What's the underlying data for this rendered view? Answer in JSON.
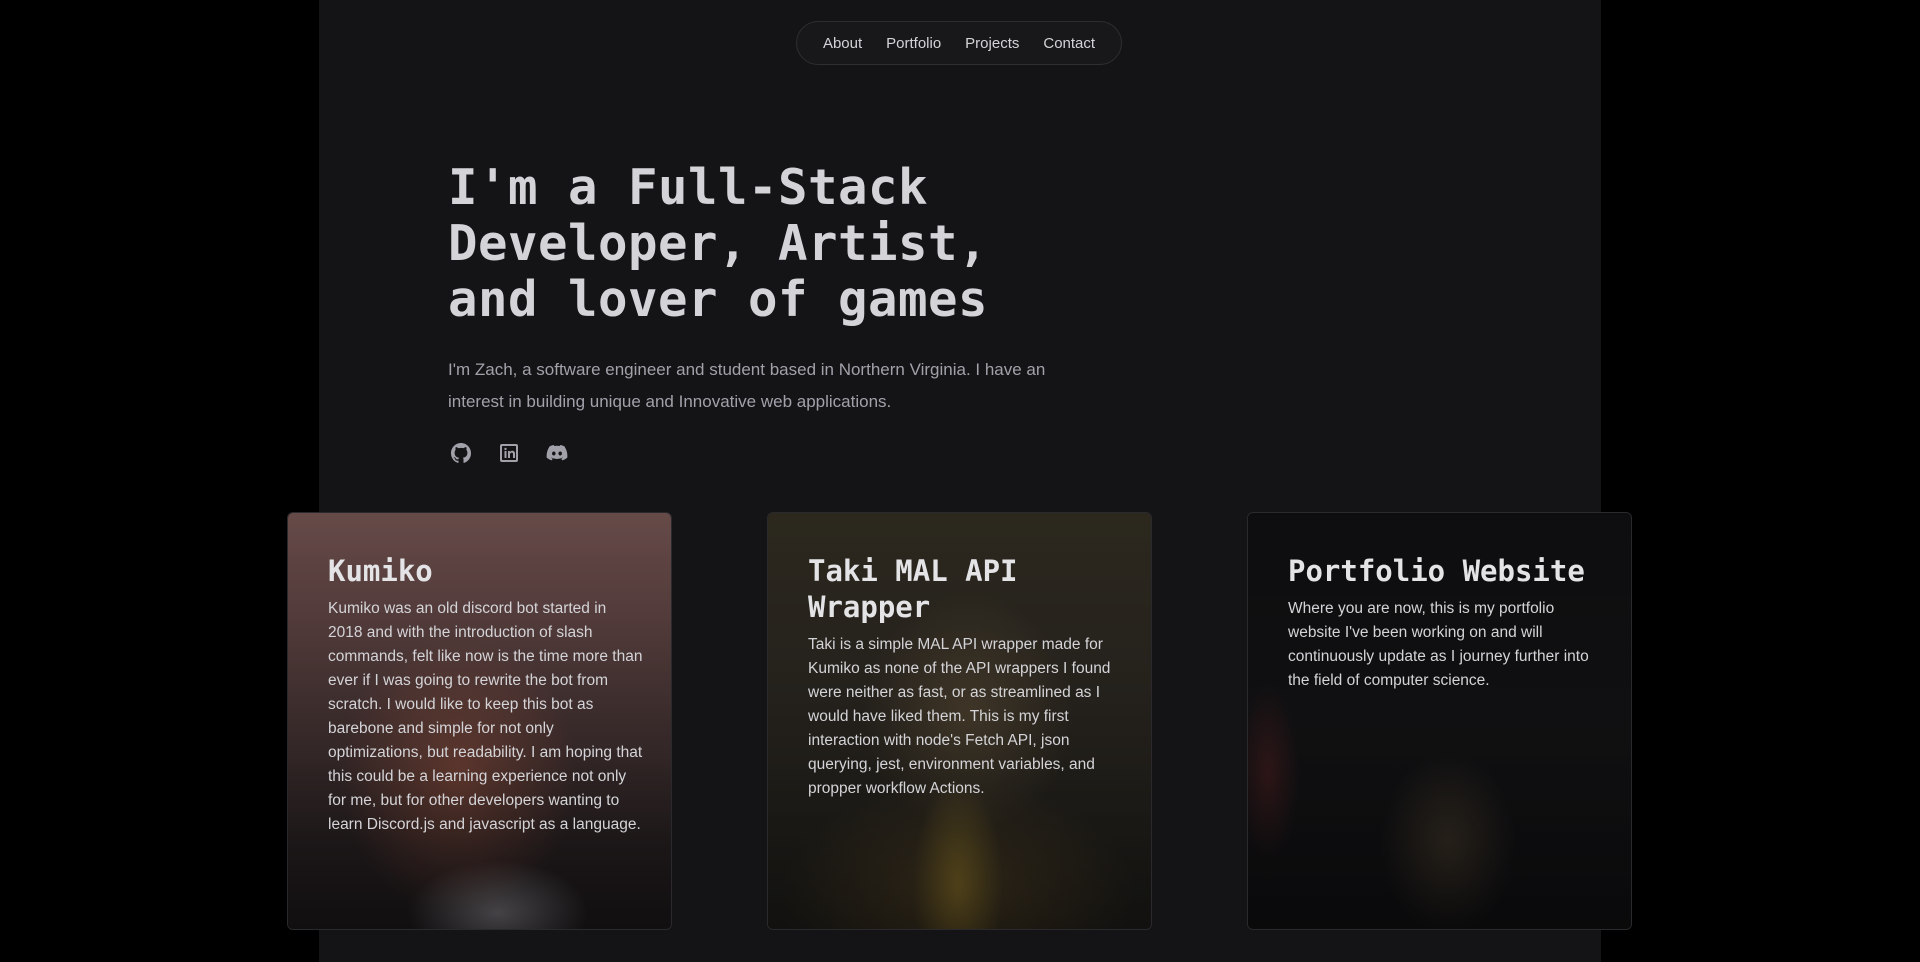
{
  "nav": {
    "items": [
      {
        "label": "About"
      },
      {
        "label": "Portfolio"
      },
      {
        "label": "Projects"
      },
      {
        "label": "Contact"
      }
    ]
  },
  "hero": {
    "title_lines": [
      "I'm a Full-Stack",
      "Developer, Artist,",
      "and lover of games"
    ],
    "description": "I'm Zach, a software engineer and student based in Northern Virginia. I have an interest in building unique and Innovative web applications.",
    "socials": [
      {
        "icon": "github-icon"
      },
      {
        "icon": "linkedin-icon"
      },
      {
        "icon": "discord-icon"
      }
    ]
  },
  "projects": [
    {
      "title": "Kumiko",
      "description": "Kumiko was an old discord bot started in 2018 and with the introduction of slash commands, felt like now is the time more than ever if I was going to rewrite the bot from scratch. I would like to keep this bot as barebone and simple for not only optimizations, but readability. I am hoping that this could be a learning experience not only for me, but for other developers wanting to learn Discord.js and javascript as a language."
    },
    {
      "title": "Taki MAL API Wrapper",
      "description": "Taki is a simple MAL API wrapper made for Kumiko as none of the API wrappers I found were neither as fast, or as streamlined as I would have liked them. This is my first interaction with node's Fetch API, json querying, jest, environment variables, and propper workflow Actions."
    },
    {
      "title": "Portfolio Website",
      "description": "Where you are now, this is my portfolio website I've been working on and will continuously update as I journey further into the field of computer science."
    }
  ],
  "colors": {
    "page_background": "#000000",
    "content_background": "#141416",
    "text_primary": "#d4d4d8",
    "text_secondary": "#a1a1aa",
    "icon_color": "#a1a1aa"
  }
}
